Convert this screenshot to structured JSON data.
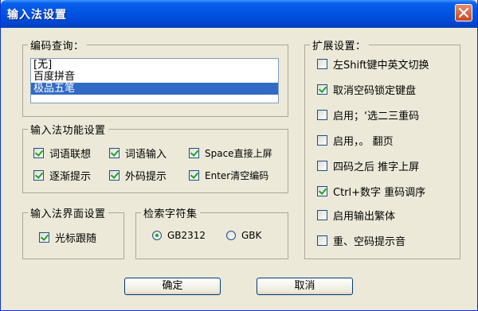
{
  "window": {
    "title": "输入法设置"
  },
  "code_query": {
    "legend": "编码查询：",
    "items": [
      "[无]",
      "百度拼音",
      "极品五笔"
    ],
    "selected_index": 2
  },
  "ime_functions": {
    "legend": "输入法功能设置",
    "options": [
      {
        "label": "词语联想",
        "checked": true
      },
      {
        "label": "词语输入",
        "checked": true
      },
      {
        "label": "Space直接上屏",
        "checked": true
      },
      {
        "label": "逐渐提示",
        "checked": true
      },
      {
        "label": "外码提示",
        "checked": true
      },
      {
        "label": "Enter清空编码",
        "checked": true
      }
    ]
  },
  "ime_ui": {
    "legend": "输入法界面设置",
    "options": [
      {
        "label": "光标跟随",
        "checked": true
      }
    ]
  },
  "charset": {
    "legend": "检索字符集",
    "options": [
      {
        "label": "GB2312",
        "selected": true
      },
      {
        "label": "GBK",
        "selected": false
      }
    ]
  },
  "extended": {
    "legend": "扩展设置：",
    "options": [
      {
        "label": "左Shift键中英文切换",
        "checked": false
      },
      {
        "label": "取消空码锁定键盘",
        "checked": true
      },
      {
        "label": "启用；‘选二三重码",
        "checked": false
      },
      {
        "label": "启用，。 翻页",
        "checked": false
      },
      {
        "label": "四码之后 推字上屏",
        "checked": false
      },
      {
        "label": "Ctrl+数字 重码调序",
        "checked": true
      },
      {
        "label": "启用输出繁体",
        "checked": false
      },
      {
        "label": "重、空码提示音",
        "checked": false
      }
    ]
  },
  "buttons": {
    "ok": "确定",
    "cancel": "取消"
  }
}
